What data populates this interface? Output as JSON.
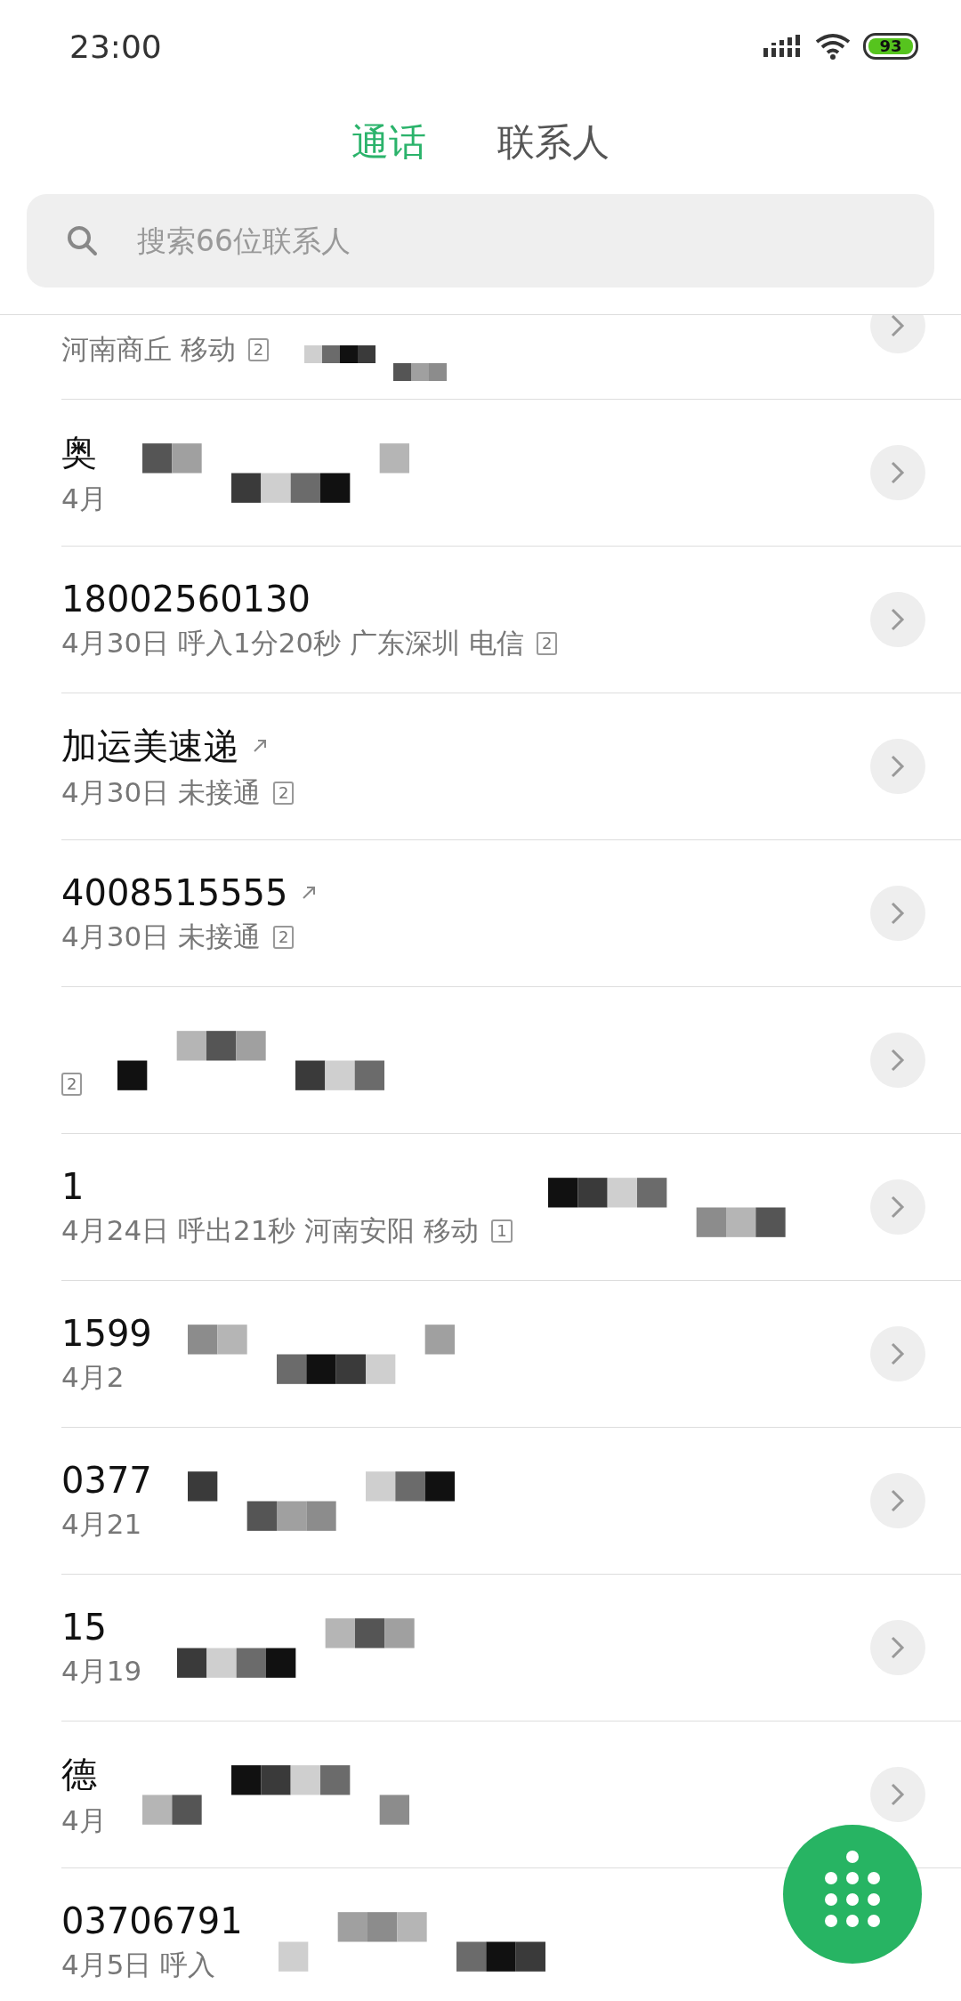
{
  "status_bar": {
    "time": "23:00",
    "battery": "93"
  },
  "tabs": [
    {
      "label": "通话",
      "selected": true
    },
    {
      "label": "联系人",
      "selected": false
    }
  ],
  "search": {
    "placeholder": "搜索66位联系人"
  },
  "calls": [
    {
      "detail": "河南商丘 移动",
      "badge": "2",
      "outgoing": false,
      "redacted": true
    },
    {
      "name": "奥",
      "detail": "4月",
      "outgoing": false,
      "redacted": true
    },
    {
      "name": "18002560130",
      "detail": "4月30日 呼入1分20秒 广东深圳 电信",
      "badge": "2",
      "outgoing": false,
      "redacted": false
    },
    {
      "name": "加运美速递",
      "detail": "4月30日 未接通",
      "badge": "2",
      "outgoing": true,
      "redacted": false
    },
    {
      "name": "4008515555",
      "detail": "4月30日 未接通",
      "badge": "2",
      "outgoing": true,
      "redacted": false
    },
    {
      "badge": "2",
      "outgoing": false,
      "redacted": true
    },
    {
      "name": "1",
      "detail": "4月24日 呼出21秒 河南安阳 移动",
      "badge": "1",
      "outgoing": false,
      "redacted": true
    },
    {
      "name": "1599",
      "detail": "4月2",
      "outgoing": false,
      "redacted": true
    },
    {
      "name": "0377",
      "detail": "4月21",
      "outgoing": false,
      "redacted": true
    },
    {
      "name": "15",
      "detail": "4月19",
      "outgoing": false,
      "redacted": true
    },
    {
      "name": "德",
      "detail": "4月",
      "outgoing": false,
      "redacted": true
    },
    {
      "name": "03706791",
      "detail": "4月5日 呼入",
      "outgoing": false,
      "redacted": true
    }
  ]
}
